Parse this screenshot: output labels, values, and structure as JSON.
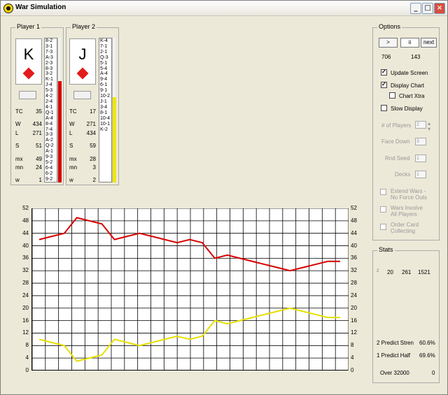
{
  "window": {
    "title": "War Simulation",
    "minimize_label": "_",
    "maximize_label": "□",
    "close_label": "×"
  },
  "players": [
    {
      "group_label": "Player 1",
      "card_rank": "K",
      "card_suit": "diamond",
      "stats": {
        "TC": "35",
        "W": "434",
        "L": "271",
        "S": "51",
        "mx": "49",
        "mn": "24",
        "w": "1"
      },
      "deck": [
        "8-2",
        "3-1",
        "7-3",
        "A-3",
        "2-3",
        "8-3",
        "3-2",
        "K-1",
        "J-4",
        "5-3",
        "4-2",
        "2-4",
        "4-1",
        "Q-1",
        "A-4",
        "8-4",
        "7-4",
        "3-3",
        "A-2",
        "Q-2",
        "A-1",
        "9-3",
        "5-2",
        "6-4",
        "6-2",
        "9-2"
      ],
      "bar_color": "#d90000",
      "bar_fill": 0.7
    },
    {
      "group_label": "Player 2",
      "card_rank": "J",
      "card_suit": "diamond",
      "stats": {
        "TC": "17",
        "W": "271",
        "L": "434",
        "S": "59",
        "mx": "28",
        "mn": "3",
        "w": "2"
      },
      "deck": [
        "K-4",
        "7-1",
        "2-1",
        "Q-3",
        "5-1",
        "5-4",
        "A-4",
        "9-4",
        "6-1",
        "9-1",
        "10-2",
        "J-1",
        "3-4",
        "8-1",
        "10-4",
        "10-1",
        "K-2"
      ],
      "bar_color": "#f0e600",
      "bar_fill": 0.59
    }
  ],
  "options": {
    "group_label": "Options",
    "buttons": [
      ">",
      "ii",
      "next"
    ],
    "counter_left": "706",
    "counter_right": "143",
    "update_screen": {
      "label": "Update Screen",
      "checked": true
    },
    "display_chart": {
      "label": "Display Chart",
      "checked": true
    },
    "chart_xtra": {
      "label": "Chart Xtra",
      "checked": false
    },
    "slow_display": {
      "label": "Slow Display",
      "checked": false
    },
    "num_players_label": "# of Players",
    "num_players_value": "2",
    "face_down_label": "Face Down",
    "face_down_value": "3",
    "rnd_seed_label": "Rnd Seed",
    "rnd_seed_value": "1",
    "decks_label": "Decks",
    "decks_value": "1",
    "extend_wars_1": "Extend Wars -",
    "extend_wars_2": "No Force Outs",
    "wars_involve_1": "Wars Involve",
    "wars_involve_2": "All Players",
    "order_card_1": "Order Card",
    "order_card_2": "Collecting"
  },
  "stats": {
    "group_label": "Stats",
    "row_values": [
      "2",
      "20",
      "261",
      "1521"
    ],
    "predict_stren_label": "2 Predict Stren",
    "predict_stren_value": "60.6%",
    "predict_half_label": "1 Predict Half",
    "predict_half_value": "69.6%",
    "over_label": "Over 32000",
    "over_value": "0"
  },
  "chart_data": {
    "type": "line",
    "ylim": [
      0,
      52
    ],
    "yticks": [
      "52",
      "48",
      "44",
      "40",
      "36",
      "32",
      "28",
      "24",
      "20",
      "16",
      "12",
      "8",
      "4",
      "0"
    ],
    "x": [
      0,
      1,
      2,
      3,
      4,
      5,
      6,
      7,
      8,
      9,
      10,
      11,
      12,
      13,
      14,
      15,
      16,
      17,
      18,
      19,
      20,
      21,
      22,
      23,
      24
    ],
    "series": [
      {
        "color": "#d80000",
        "values": [
          42,
          43,
          44,
          49,
          48,
          47,
          42,
          43,
          44,
          43,
          42,
          41,
          42,
          41,
          36,
          37,
          36,
          35,
          34,
          33,
          32,
          33,
          34,
          35,
          35
        ]
      },
      {
        "color": "#e6e000",
        "values": [
          10,
          9,
          8,
          3,
          4,
          5,
          10,
          9,
          8,
          9,
          10,
          11,
          10,
          11,
          16,
          15,
          16,
          17,
          18,
          19,
          20,
          19,
          18,
          17,
          17
        ]
      }
    ]
  }
}
